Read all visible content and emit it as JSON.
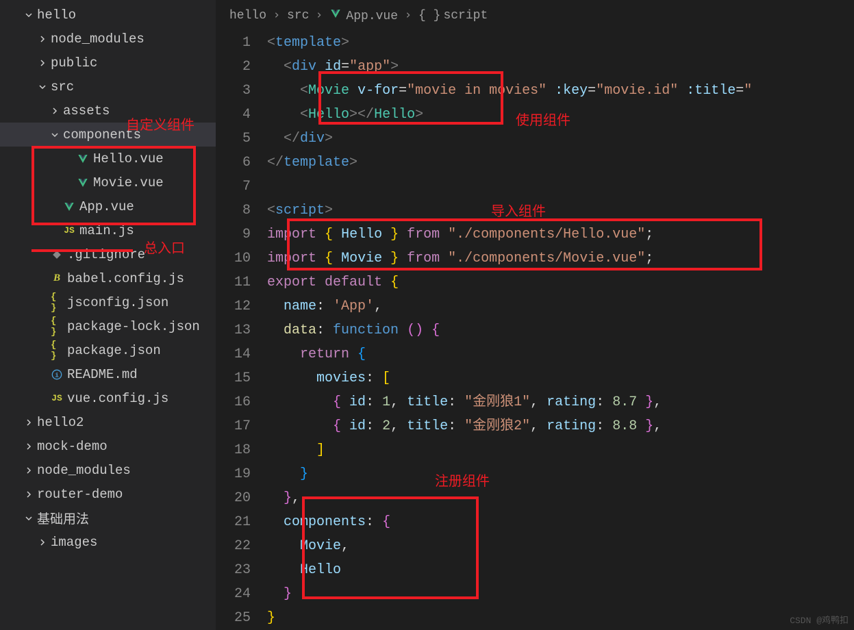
{
  "sidebar": {
    "items": [
      {
        "indent": 34,
        "chev": "down",
        "name": "hello"
      },
      {
        "indent": 54,
        "chev": "right",
        "name": "node_modules"
      },
      {
        "indent": 54,
        "chev": "right",
        "name": "public"
      },
      {
        "indent": 54,
        "chev": "down",
        "name": "src"
      },
      {
        "indent": 72,
        "chev": "right",
        "name": "assets"
      },
      {
        "indent": 72,
        "chev": "down",
        "name": "components",
        "selected": true
      },
      {
        "indent": 92,
        "icon": "vue",
        "name": "Hello.vue"
      },
      {
        "indent": 92,
        "icon": "vue",
        "name": "Movie.vue"
      },
      {
        "indent": 72,
        "icon": "vue",
        "name": "App.vue"
      },
      {
        "indent": 72,
        "icon": "js",
        "name": "main.js"
      },
      {
        "indent": 54,
        "icon": "git",
        "name": ".gitignore"
      },
      {
        "indent": 54,
        "icon": "babel",
        "name": "babel.config.js"
      },
      {
        "indent": 54,
        "icon": "json",
        "name": "jsconfig.json"
      },
      {
        "indent": 54,
        "icon": "json",
        "name": "package-lock.json"
      },
      {
        "indent": 54,
        "icon": "json",
        "name": "package.json"
      },
      {
        "indent": 54,
        "icon": "info",
        "name": "README.md"
      },
      {
        "indent": 54,
        "icon": "js",
        "name": "vue.config.js"
      },
      {
        "indent": 34,
        "chev": "right",
        "name": "hello2"
      },
      {
        "indent": 34,
        "chev": "right",
        "name": "mock-demo"
      },
      {
        "indent": 34,
        "chev": "right",
        "name": "node_modules"
      },
      {
        "indent": 34,
        "chev": "right",
        "name": "router-demo"
      },
      {
        "indent": 34,
        "chev": "down",
        "name": "基础用法"
      },
      {
        "indent": 54,
        "chev": "right",
        "name": "images"
      }
    ]
  },
  "annotations": {
    "custom_component": "自定义组件",
    "main_entry": "总入口",
    "use_component": "使用组件",
    "import_component": "导入组件",
    "register_component": "注册组件"
  },
  "breadcrumbs": {
    "items": [
      "hello",
      "src",
      "App.vue",
      "script"
    ],
    "vue_idx": 2,
    "braces_idx": 3
  },
  "code": {
    "lines": [
      {
        "n": 1,
        "html": "<span class='t-tag'>&lt;</span><span class='t-name'>template</span><span class='t-tag'>&gt;</span>"
      },
      {
        "n": 2,
        "html": "  <span class='t-tag'>&lt;</span><span class='t-name'>div</span> <span class='t-attr'>id</span>=<span class='t-str'>\"app\"</span><span class='t-tag'>&gt;</span>"
      },
      {
        "n": 3,
        "html": "    <span class='t-tag'>&lt;</span><span class='t-cls'>Movie</span> <span class='t-attr'>v-for</span>=<span class='t-str'>\"movie in movies\"</span> <span class='t-attr'>:key</span>=<span class='t-str'>\"movie.id\"</span> <span class='t-attr'>:title</span>=<span class='t-str'>\"</span>"
      },
      {
        "n": 4,
        "html": "    <span class='t-tag'>&lt;</span><span class='t-cls'>Hello</span><span class='t-tag'>&gt;&lt;/</span><span class='t-cls'>Hello</span><span class='t-tag'>&gt;</span>"
      },
      {
        "n": 5,
        "html": "  <span class='t-tag'>&lt;/</span><span class='t-name'>div</span><span class='t-tag'>&gt;</span>"
      },
      {
        "n": 6,
        "html": "<span class='t-tag'>&lt;/</span><span class='t-name'>template</span><span class='t-tag'>&gt;</span>"
      },
      {
        "n": 7,
        "html": ""
      },
      {
        "n": 8,
        "html": "<span class='t-tag'>&lt;</span><span class='t-name'>script</span><span class='t-tag'>&gt;</span>"
      },
      {
        "n": 9,
        "html": "<span class='t-kw'>import</span> <span class='t-br'>{</span> <span class='t-prop'>Hello</span> <span class='t-br'>}</span> <span class='t-kw'>from</span> <span class='t-str'>\"./components/Hello.vue\"</span>;"
      },
      {
        "n": 10,
        "html": "<span class='t-kw'>import</span> <span class='t-br'>{</span> <span class='t-prop'>Movie</span> <span class='t-br'>}</span> <span class='t-kw'>from</span> <span class='t-str'>\"./components/Movie.vue\"</span>;"
      },
      {
        "n": 11,
        "html": "<span class='t-kw'>export</span> <span class='t-kw'>default</span> <span class='t-br'>{</span>"
      },
      {
        "n": 12,
        "html": "  <span class='t-prop'>name</span>: <span class='t-str'>'App'</span>,"
      },
      {
        "n": 13,
        "html": "  <span class='t-fn'>data</span>: <span class='t-pw'>function</span> <span class='t-br2'>()</span> <span class='t-br2'>{</span>"
      },
      {
        "n": 14,
        "html": "    <span class='t-kw'>return</span> <span class='t-br3'>{</span>"
      },
      {
        "n": 15,
        "html": "      <span class='t-prop'>movies</span>: <span class='t-br'>[</span>"
      },
      {
        "n": 16,
        "html": "        <span class='t-br2'>{</span> <span class='t-prop'>id</span>: <span class='t-num'>1</span>, <span class='t-prop'>title</span>: <span class='t-str'>\"金刚狼1\"</span>, <span class='t-prop'>rating</span>: <span class='t-num'>8.7</span> <span class='t-br2'>}</span>,"
      },
      {
        "n": 17,
        "html": "        <span class='t-br2'>{</span> <span class='t-prop'>id</span>: <span class='t-num'>2</span>, <span class='t-prop'>title</span>: <span class='t-str'>\"金刚狼2\"</span>, <span class='t-prop'>rating</span>: <span class='t-num'>8.8</span> <span class='t-br2'>}</span>,"
      },
      {
        "n": 18,
        "html": "      <span class='t-br'>]</span>"
      },
      {
        "n": 19,
        "html": "    <span class='t-br3'>}</span>"
      },
      {
        "n": 20,
        "html": "  <span class='t-br2'>}</span>,"
      },
      {
        "n": 21,
        "html": "  <span class='t-prop'>components</span>: <span class='t-br2'>{</span>"
      },
      {
        "n": 22,
        "html": "    <span class='t-prop'>Movie</span>,"
      },
      {
        "n": 23,
        "html": "    <span class='t-prop'>Hello</span>"
      },
      {
        "n": 24,
        "html": "  <span class='t-br2'>}</span>"
      },
      {
        "n": 25,
        "html": "<span class='t-br'>}</span>"
      }
    ]
  },
  "watermark": "CSDN @鸡鸭扣"
}
